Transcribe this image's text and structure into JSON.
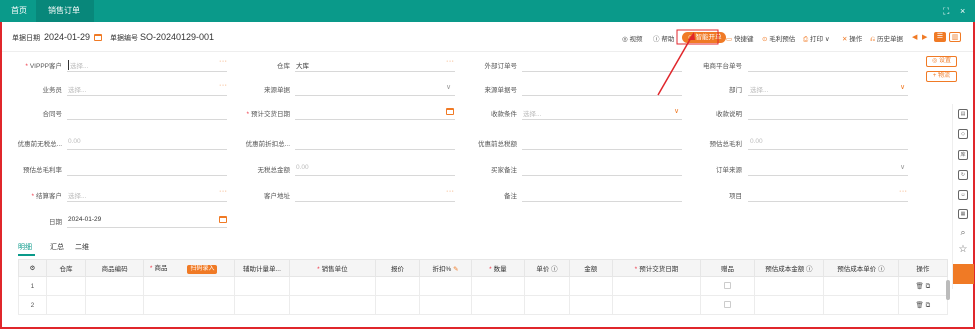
{
  "titlebar": {
    "home_tab": "首页",
    "sales_tab": "销售订单",
    "tab_close": "×",
    "expand_icon": "⛶",
    "close_icon": "×"
  },
  "toolbar": {
    "doc_date_label": "单据日期",
    "doc_date_value": "2024-01-29",
    "doc_no_label": "单据编号",
    "doc_no_value": "SO-20240129-001",
    "video": "视频",
    "help": "帮助",
    "smart_order": "智能开单",
    "shortcuts": "快捷键",
    "gross_profit": "毛利预估",
    "print": "打印",
    "operation": "操作",
    "history": "历史单据"
  },
  "side_buttons": {
    "settings": "◎ 设置",
    "logistics": "+ 物流"
  },
  "form": {
    "vip_customer": {
      "label": "VIPPP客户",
      "placeholder": "选择..."
    },
    "warehouse": {
      "label": "仓库",
      "value": "大库"
    },
    "external_order_no": {
      "label": "外部订单号"
    },
    "ecommerce_order_no": {
      "label": "电商平台单号"
    },
    "salesperson": {
      "label": "业务员",
      "placeholder": "选择..."
    },
    "source_doc": {
      "label": "来源单据"
    },
    "source_doc_no": {
      "label": "来源单据号"
    },
    "department": {
      "label": "部门",
      "placeholder": "选择..."
    },
    "contract_no": {
      "label": "合同号"
    },
    "expected_delivery_date": {
      "label": "预计交货日期"
    },
    "payment_terms": {
      "label": "收款条件",
      "placeholder": "选择..."
    },
    "payment_desc": {
      "label": "收款说明"
    },
    "pre_discount_total": {
      "label": "优惠前无税总...",
      "value": "0.00"
    },
    "pre_discount_after": {
      "label": "优惠前折扣总..."
    },
    "pre_discount_tax_total": {
      "label": "优惠前总税额"
    },
    "est_gross_profit": {
      "label": "预估总毛利",
      "value": "0.00"
    },
    "est_gross_margin": {
      "label": "预估总毛利率"
    },
    "untaxed_total": {
      "label": "无税总金额",
      "value": "0.00"
    },
    "buyer_notes": {
      "label": "买家备注"
    },
    "order_source": {
      "label": "订单来源"
    },
    "settlement_customer": {
      "label": "结算客户",
      "placeholder": "选择..."
    },
    "customer_address": {
      "label": "客户地址"
    },
    "remarks": {
      "label": "备注"
    },
    "project": {
      "label": "项目"
    },
    "date": {
      "label": "日期",
      "value": "2024-01-29"
    }
  },
  "tabs": [
    "明细",
    "汇总",
    "二维"
  ],
  "table": {
    "settings_icon": "⚙",
    "columns": [
      "仓库",
      "商品编码",
      "商品",
      "辅助计量单...",
      "销售单位",
      "报价",
      "折扣%",
      "数量",
      "单价",
      "金额",
      "预计交货日期",
      "赠品",
      "预估成本金额",
      "预估成本单价",
      "操作"
    ],
    "auto_input_badge": "扫码录入",
    "rows": [
      {
        "no": "1"
      },
      {
        "no": "2"
      }
    ]
  },
  "colors": {
    "brand": "#0a9a8a",
    "accent": "#f07a25",
    "annotation": "#e0262b"
  }
}
